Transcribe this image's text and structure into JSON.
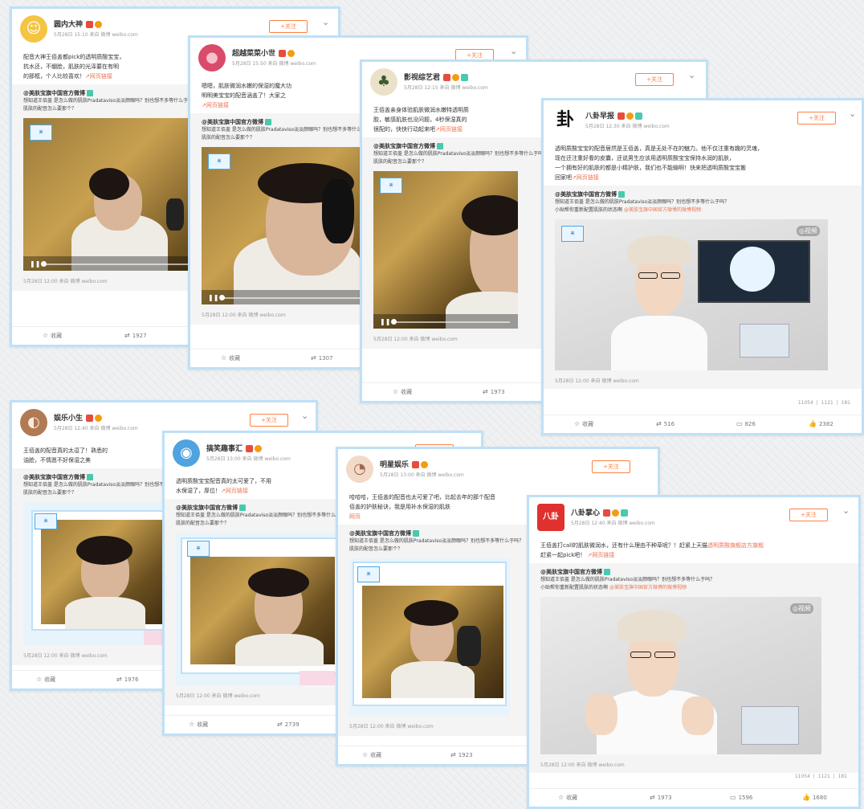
{
  "follow_label": "+关注",
  "posts": [
    {
      "user": "圆内大神",
      "time": "5月28日 15:10 来自 微博 weibo.com",
      "text": "配音大神王佰盖都pick的透明质酸宝宝，",
      "text2": "抗水还，不绷脸，肌肤的光泽要在有明",
      "text3": "的那框，个人比较喜欢！",
      "link": "网页链接",
      "avatar": "☺",
      "collect": "收藏",
      "repost": "1927"
    },
    {
      "user": "超越菜菜小世",
      "time": "5月28日 15:50 来自 微博 weibo.com",
      "text": "嗯嗯，肌肤微润水嫩的保湿的魔大功",
      "text2": "明明美宝宝的配音涵盖了！大家之",
      "link": "网页链接",
      "avatar": "●",
      "collect": "收藏",
      "repost": "1307"
    },
    {
      "user": "影视综艺君",
      "time": "5月28日 12:15 来自 微博 weibo.com",
      "text": "王佰盖亲身体验肌肤微润水嫩特透明质",
      "text2": "胶，敏感肌肤也没问题，4秒保湿真的",
      "text3": "很配的，快快行动起来吧",
      "link": "网页链接",
      "avatar": "♣",
      "collect": "收藏",
      "repost": "1973"
    },
    {
      "user": "八卦早报",
      "time": "5月28日 12:30 来自 微博 weibo.com",
      "text": "透明质酸宝宝的配音居然是王佰盖，真是无处不在的魅力。他不仅注重有趣的灵魂，",
      "text2": "现在还注重好看的皮囊，还说男生应该用透明质酸宝宝保持水润的肌肤，",
      "text3": "一个拥有好的肌肤的都是小精护肤，我们也不能输啊！快来把透明质酸宝宝搬",
      "text4": "回家吧",
      "link": "网页链接",
      "avatar": "卦",
      "collect": "收藏",
      "repost": "516",
      "comments": "826",
      "likes": "2382",
      "stat1": "11054",
      "stat2": "1121",
      "stat3": "181"
    },
    {
      "user": "娱乐小生",
      "time": "5月28日 12:40 来自 微博 weibo.com",
      "text": "王佰盖的配音真的太逗了！熟悉的",
      "text2": "油脸，不情愿不好保湿之美",
      "avatar": "◐",
      "collect": "收藏",
      "repost": "1976"
    },
    {
      "user": "搞笑趣事汇",
      "time": "5月28日 13:00 来自 微博 weibo.com",
      "text": "透明质酸宝宝配音真的太可爱了，不用",
      "text2": "水保湿了，厚位！",
      "link": "网页链接",
      "avatar": "◉",
      "collect": "收藏",
      "repost": "2739"
    },
    {
      "user": "明星娱乐",
      "time": "5月28日 13:00 来自 微博 weibo.com",
      "text": "哈哈哈，王佰盖的配音也太可爱了吧，比起去年的那个配音",
      "text2": "佰盖的护肤秘诀，我是用补水保湿的肌肤",
      "link": "网页",
      "avatar": "◔",
      "collect": "收藏",
      "repost": "1923"
    },
    {
      "user": "八卦掌心",
      "time": "5月28日 12:40 来自 微博 weibo.com",
      "text": "王佰盖打call的肌肤微润水，还有什么理由不种草呢？！赶紧上天猫",
      "text2": "透明质酸旗舰店方旗舰",
      "text3": "赶紧一起pick吧！",
      "link": "网页链接",
      "avatar": "八卦",
      "collect": "收藏",
      "repost": "1973",
      "comments": "1596",
      "likes": "1680",
      "stat1": "11054",
      "stat2": "1121",
      "stat3": "181"
    }
  ],
  "repost": {
    "author": "@美肤宝旗中国官方微博",
    "text1": "想知道王佰盖 是怎么做的肌肤Pradataviso淡淡颜眼吗？别也想不多等什么于吗？",
    "text2": "肌肤的配音怎么要那个？",
    "text3": "小贴帮你重新配置肌肤的状态啊",
    "hl": "@美肤宝旗中国官方微博的微博视频",
    "timestamp": "5月28日 12:00 来自 微博 weibo.com",
    "video_mark": "◎视频"
  },
  "colors": {
    "accent": "#ff8140",
    "frame": "#bfe0f7",
    "link": "#eb7350"
  }
}
